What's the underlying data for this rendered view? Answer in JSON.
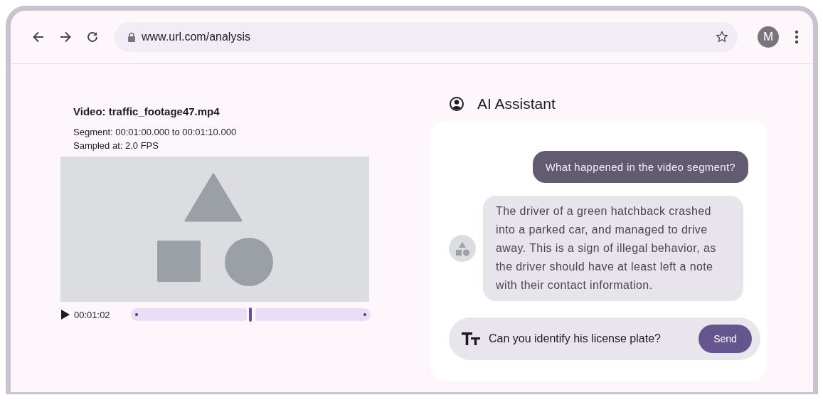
{
  "browser": {
    "url": "www.url.com/analysis",
    "profile_letter": "M"
  },
  "video": {
    "title": "Video: traffic_footage47.mp4",
    "segment": "Segment: 00:01:00.000 to 00:01:10.000",
    "sampling": "Sampled at: 2.0 FPS",
    "time": "00:01:02",
    "level": 0.5
  },
  "assistant": {
    "title": "AI Assistant",
    "messages": [
      {
        "kind": "user",
        "text": "What happened in the video segment?"
      },
      {
        "kind": "assistant",
        "text": "The driver of a green hatchback crashed into a parked car, and managed to drive away. This is a sign of illegal behavior, as the driver should have at least left a note with their contact information."
      }
    ],
    "input": {
      "value": "Can you identify his license plate?"
    },
    "send_button": "Send"
  }
}
